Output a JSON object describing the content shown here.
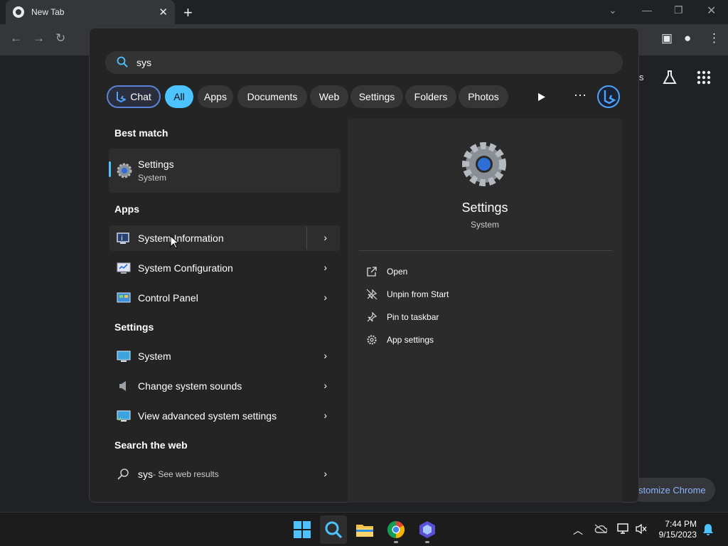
{
  "chrome": {
    "tab_title": "New Tab",
    "customize_label": "stomize Chrome",
    "ntp_partial_text": "s"
  },
  "search": {
    "query": "sys"
  },
  "filters": [
    {
      "id": "chat",
      "label": "Chat"
    },
    {
      "id": "all",
      "label": "All"
    },
    {
      "id": "apps",
      "label": "Apps"
    },
    {
      "id": "documents",
      "label": "Documents"
    },
    {
      "id": "web",
      "label": "Web"
    },
    {
      "id": "settings",
      "label": "Settings"
    },
    {
      "id": "folders",
      "label": "Folders"
    },
    {
      "id": "photos",
      "label": "Photos"
    }
  ],
  "results": {
    "best_match_header": "Best match",
    "best_match": {
      "title": "Settings",
      "subtitle": "System"
    },
    "apps_header": "Apps",
    "apps": [
      {
        "label": "System Information",
        "icon": "system-information-icon"
      },
      {
        "label": "System Configuration",
        "icon": "system-configuration-icon"
      },
      {
        "label": "Control Panel",
        "icon": "control-panel-icon"
      }
    ],
    "settings_header": "Settings",
    "settings": [
      {
        "label": "System",
        "icon": "monitor-icon"
      },
      {
        "label": "Change system sounds",
        "icon": "speaker-icon"
      },
      {
        "label": "View advanced system settings",
        "icon": "advanced-settings-icon"
      }
    ],
    "web_header": "Search the web",
    "web": {
      "query": "sys",
      "suffix": " - See web results"
    }
  },
  "detail": {
    "name": "Settings",
    "category": "System",
    "actions": [
      {
        "label": "Open",
        "icon": "open-external-icon"
      },
      {
        "label": "Unpin from Start",
        "icon": "unpin-icon"
      },
      {
        "label": "Pin to taskbar",
        "icon": "pin-icon"
      },
      {
        "label": "App settings",
        "icon": "gear-icon"
      }
    ]
  },
  "taskbar": {
    "time": "7:44 PM",
    "date": "9/15/2023"
  },
  "colors": {
    "accent": "#4cc2ff",
    "panel_bg": "#242424",
    "chrome_link": "#8ab4f8"
  }
}
